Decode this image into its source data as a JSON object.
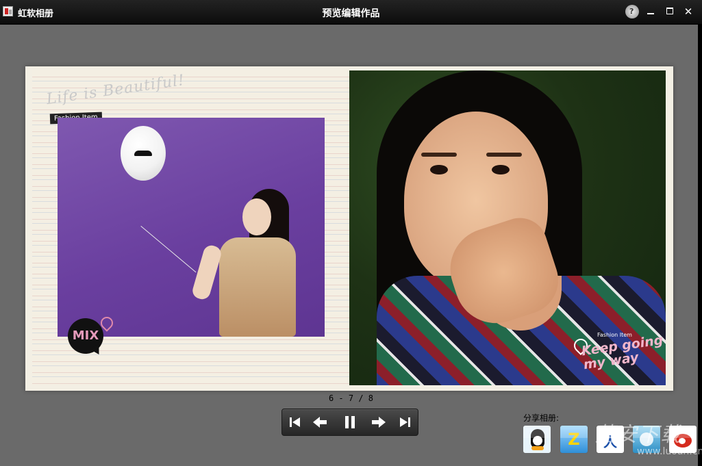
{
  "window": {
    "app_name": "虹软相册",
    "title": "预览编辑作品",
    "controls": {
      "help_icon": "help-globe-icon",
      "minimize": "minimize-icon",
      "maximize": "maximize-icon",
      "close": "close-icon"
    }
  },
  "album": {
    "left_page": {
      "decor_text": "Life is Beautiful!",
      "tag": "Fashion Item",
      "sticker": "MIX"
    },
    "right_page": {
      "tag": "Fashion Item",
      "caption": "Keep going my way"
    }
  },
  "pager": {
    "indicator": "6 - 7 / 8"
  },
  "player": {
    "icons": [
      "skip-to-first-icon",
      "previous-arrow-icon",
      "pause-icon",
      "next-arrow-icon",
      "skip-to-last-icon"
    ]
  },
  "share": {
    "label": "分享相册:",
    "icons": [
      "qq-icon",
      "qzone-icon",
      "renren-icon",
      "kaixin-icon",
      "weibo-icon"
    ],
    "zone_glyph": "Z",
    "renren_glyph": "人"
  },
  "watermark": {
    "text": "落安下载",
    "url": "www.luoan.cn"
  },
  "colors": {
    "background": "#6a6a6a",
    "titlebar": "#141414",
    "pink_accent": "#f1b6cb"
  }
}
